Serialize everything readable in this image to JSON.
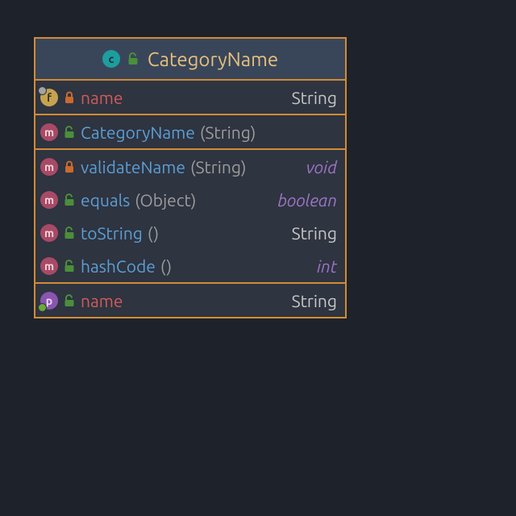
{
  "class": {
    "name": "CategoryName",
    "badge": "c",
    "visibility": "public"
  },
  "sections": [
    {
      "rows": [
        {
          "badge": "f",
          "overlay": "tl",
          "visibility": "private",
          "name": "name",
          "name_style": "red",
          "params": "",
          "type": "String",
          "type_style": ""
        }
      ]
    },
    {
      "rows": [
        {
          "badge": "m",
          "overlay": "",
          "visibility": "public",
          "name": "CategoryName",
          "name_style": "",
          "params": "(String)",
          "type": "",
          "type_style": ""
        }
      ]
    },
    {
      "rows": [
        {
          "badge": "m",
          "overlay": "",
          "visibility": "private",
          "name": "validateName",
          "name_style": "",
          "params": "(String)",
          "type": "void",
          "type_style": "italic"
        },
        {
          "badge": "m",
          "overlay": "",
          "visibility": "public",
          "name": "equals",
          "name_style": "",
          "params": "(Object)",
          "type": "boolean",
          "type_style": "italic"
        },
        {
          "badge": "m",
          "overlay": "",
          "visibility": "public",
          "name": "toString",
          "name_style": "",
          "params": "()",
          "type": "String",
          "type_style": ""
        },
        {
          "badge": "m",
          "overlay": "",
          "visibility": "public",
          "name": "hashCode",
          "name_style": "",
          "params": "()",
          "type": "int",
          "type_style": "italic"
        }
      ]
    },
    {
      "rows": [
        {
          "badge": "p",
          "overlay": "bl",
          "visibility": "public",
          "name": "name",
          "name_style": "red",
          "params": "",
          "type": "String",
          "type_style": ""
        }
      ]
    }
  ]
}
